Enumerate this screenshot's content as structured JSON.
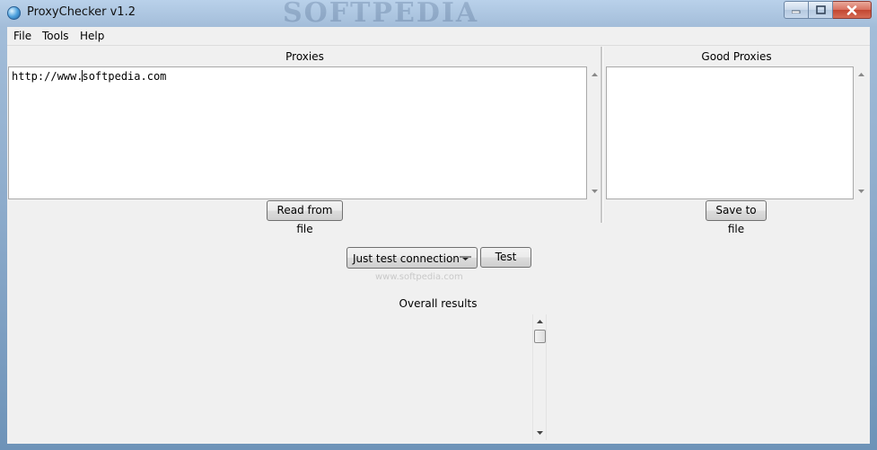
{
  "window": {
    "title": "ProxyChecker v1.2",
    "watermark": "SOFTPEDIA"
  },
  "menu": {
    "items": [
      "File",
      "Tools",
      "Help"
    ]
  },
  "proxies": {
    "label": "Proxies",
    "text_before_caret": "http://www.",
    "text_after_caret": "softpedia.com",
    "read_button": "Read from file"
  },
  "good_proxies": {
    "label": "Good Proxies",
    "save_button": "Save to file"
  },
  "test": {
    "mode_selected": "Just test connection",
    "test_button": "Test",
    "watermark": "www.softpedia.com"
  },
  "results": {
    "label": "Overall results"
  },
  "icons": {
    "app": "globe-icon",
    "minimize": "minimize-icon",
    "maximize": "maximize-icon",
    "close": "close-icon",
    "scroll_up": "scroll-up-arrow-icon",
    "scroll_down": "scroll-down-arrow-icon",
    "dropdown": "dropdown-arrow-icon"
  }
}
